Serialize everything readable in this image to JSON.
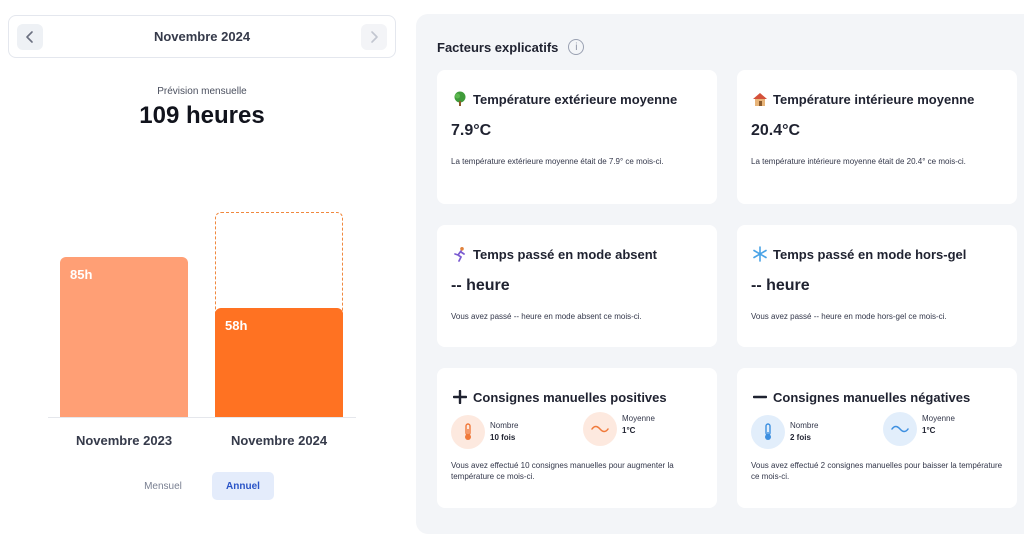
{
  "nav": {
    "month": "Novembre 2024",
    "prev_icon": "chevron-left-icon",
    "next_icon": "chevron-right-icon"
  },
  "forecast": {
    "label": "Prévision mensuelle",
    "value": "109 heures"
  },
  "chart_data": {
    "type": "bar",
    "categories": [
      "Novembre 2023",
      "Novembre 2024"
    ],
    "values": [
      85,
      58
    ],
    "forecast_value": 109,
    "unit": "h",
    "data_labels": [
      "85h",
      "58h"
    ],
    "colors": [
      "#ff9f75",
      "#ff7222"
    ],
    "ylim": [
      0,
      120
    ]
  },
  "toggles": {
    "mensuel": "Mensuel",
    "annuel": "Annuel",
    "active": "annuel"
  },
  "factors": {
    "title": "Facteurs explicatifs",
    "info_icon": "info-icon",
    "cards": {
      "ext_temp": {
        "icon": "tree-icon",
        "title": "Température extérieure moyenne",
        "value": "7.9°C",
        "desc": "La température extérieure moyenne était de 7.9° ce mois-ci."
      },
      "int_temp": {
        "icon": "house-icon",
        "title": "Température intérieure moyenne",
        "value": "20.4°C",
        "desc": "La température intérieure moyenne était de 20.4° ce mois-ci."
      },
      "absent": {
        "icon": "running-person-icon",
        "title": "Temps passé en mode absent",
        "value": "-- heure",
        "desc": "Vous avez passé -- heure en mode absent ce mois-ci."
      },
      "frost": {
        "icon": "snowflake-icon",
        "title": "Temps passé en mode hors-gel",
        "value": "-- heure",
        "desc": "Vous avez passé -- heure en mode hors-gel ce mois-ci."
      },
      "positive": {
        "icon": "plus-icon",
        "title": "Consignes manuelles positives",
        "count_label": "Nombre",
        "count_value": "10 fois",
        "avg_label": "Moyenne",
        "avg_value": "1°C",
        "desc": "Vous avez effectué 10 consignes manuelles pour augmenter la température ce mois-ci.",
        "accent": "#f0793a",
        "accent_bg": "#fde9df"
      },
      "negative": {
        "icon": "minus-icon",
        "title": "Consignes manuelles négatives",
        "count_label": "Nombre",
        "count_value": "2 fois",
        "avg_label": "Moyenne",
        "avg_value": "1°C",
        "desc": "Vous avez effectué 2 consignes manuelles pour baisser la température ce mois-ci.",
        "accent": "#3d8fe0",
        "accent_bg": "#e2eefb"
      }
    }
  }
}
